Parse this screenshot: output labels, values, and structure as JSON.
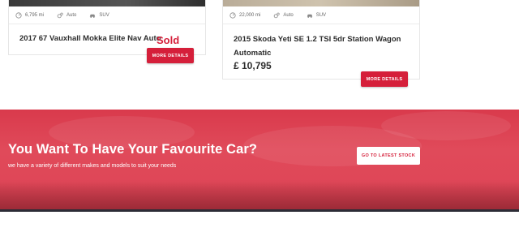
{
  "listings": [
    {
      "mileage": "6,795 mi",
      "transmission": "Auto",
      "body": "SUV",
      "title": "2017 67 Vauxhall Mokka Elite Nav Auto",
      "status": "Sold",
      "button_label": "MORE DETAILS"
    },
    {
      "mileage": "22,000 mi",
      "transmission": "Auto",
      "body": "SUV",
      "title": "2015 Skoda Yeti SE 1.2 TSI 5dr Station Wagon Automatic",
      "price": "£ 10,795",
      "button_label": "MORE DETAILS"
    }
  ],
  "banner": {
    "title": "You Want To Have Your Favourite Car?",
    "subtitle": "we have a variety of different makes and models to suit your needs",
    "button_label": "GO TO LATEST STOCK"
  },
  "colors": {
    "accent": "#d51f3a",
    "banner_bg": "#df4758",
    "text_dark": "#2d2d2d",
    "footer": "#2c2c36"
  },
  "icons": [
    "speedometer-icon",
    "gear-icon",
    "car-icon"
  ]
}
